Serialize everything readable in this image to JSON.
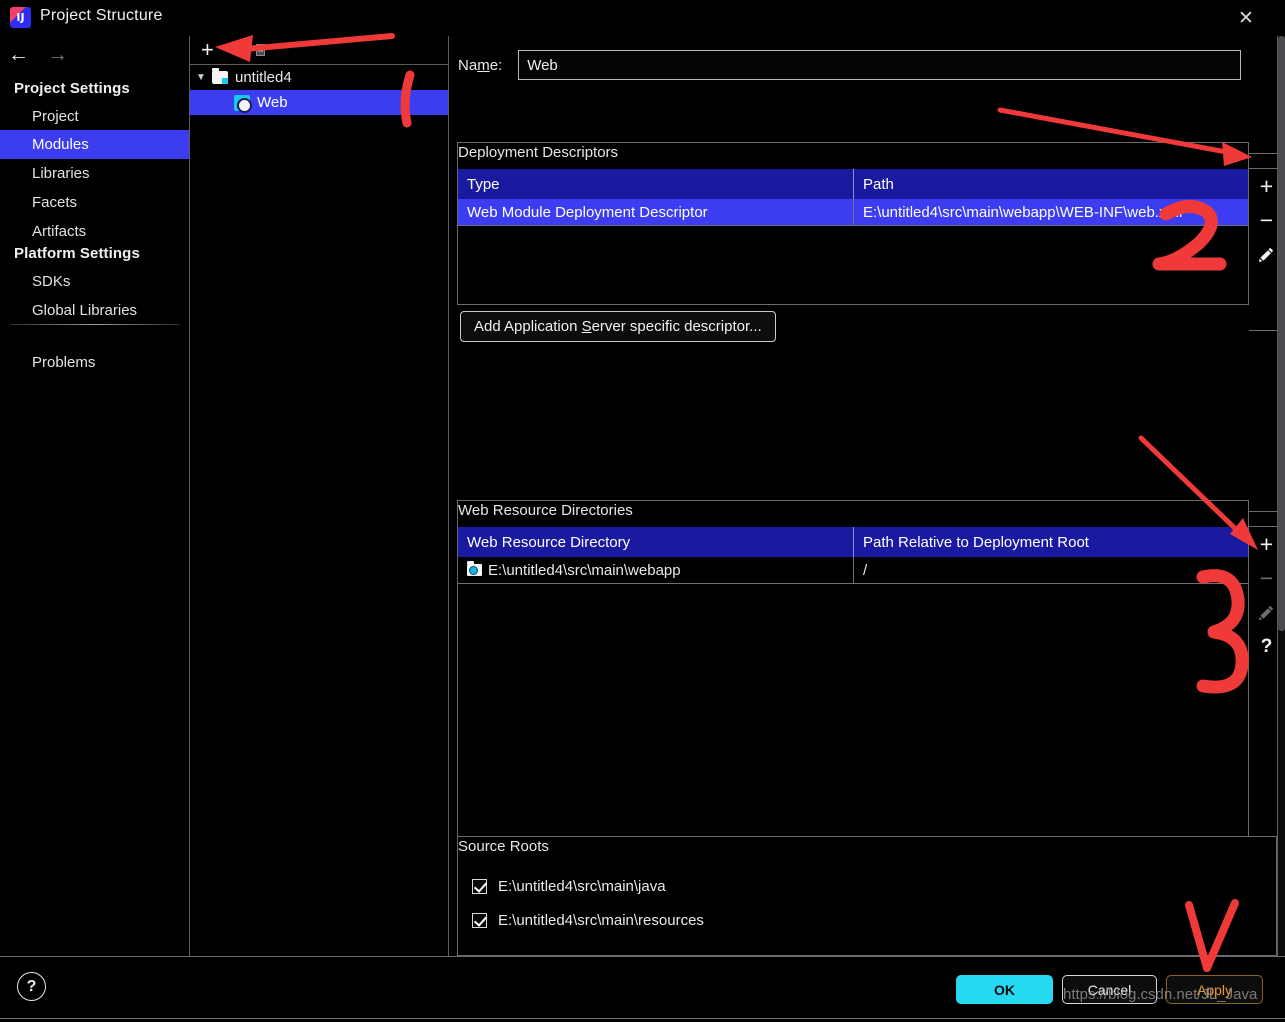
{
  "window": {
    "title": "Project Structure",
    "app_icon": "intellij-idea-icon",
    "close_icon": "close-icon"
  },
  "sidebar": {
    "back_icon": "arrow-left-icon",
    "forward_icon": "arrow-right-icon",
    "groups": [
      {
        "heading": "Project Settings",
        "items": [
          {
            "label": "Project",
            "selected": false
          },
          {
            "label": "Modules",
            "selected": true
          },
          {
            "label": "Libraries",
            "selected": false
          },
          {
            "label": "Facets",
            "selected": false
          },
          {
            "label": "Artifacts",
            "selected": false
          }
        ]
      },
      {
        "heading": "Platform Settings",
        "items": [
          {
            "label": "SDKs",
            "selected": false
          },
          {
            "label": "Global Libraries",
            "selected": false
          }
        ]
      }
    ],
    "problems_label": "Problems"
  },
  "tree": {
    "toolbar": {
      "add_icon": "plus-icon",
      "copy_icon": "copy-icon"
    },
    "nodes": [
      {
        "label": "untitled4",
        "icon": "folder-icon",
        "expanded": true,
        "selected": false
      },
      {
        "label": "Web",
        "icon": "web-module-icon",
        "selected": true
      }
    ]
  },
  "main": {
    "name": {
      "label_pre": "Na",
      "label_mnemonic": "m",
      "label_post": "e:",
      "value": "Web",
      "placeholder": ""
    },
    "deployment_descriptors": {
      "group_label": "Deployment Descriptors",
      "columns": [
        "Type",
        "Path"
      ],
      "rows": [
        {
          "type": "Web Module Deployment Descriptor",
          "path": "E:\\untitled4\\src\\main\\webapp\\WEB-INF\\web.xml",
          "selected": true
        }
      ],
      "actions": [
        {
          "name": "add-descriptor-button",
          "icon": "plus-icon",
          "glyph": "+",
          "disabled": false
        },
        {
          "name": "remove-descriptor-button",
          "icon": "minus-icon",
          "glyph": "−",
          "disabled": false
        },
        {
          "name": "edit-descriptor-button",
          "icon": "pencil-icon",
          "glyph": "pencil",
          "disabled": false
        }
      ],
      "add_app_server_button": {
        "pre": "Add Application ",
        "mnemonic": "S",
        "post": "erver specific descriptor..."
      }
    },
    "web_resource_directories": {
      "group_label": "Web Resource Directories",
      "columns": [
        "Web Resource Directory",
        "Path Relative to Deployment Root"
      ],
      "rows": [
        {
          "directory": "E:\\untitled4\\src\\main\\webapp",
          "relative_path": "/",
          "icon": "directory-icon",
          "selected": false
        }
      ],
      "actions": [
        {
          "name": "add-resource-dir-button",
          "icon": "plus-icon",
          "glyph": "+",
          "disabled": false
        },
        {
          "name": "remove-resource-dir-button",
          "icon": "minus-icon",
          "glyph": "−",
          "disabled": true
        },
        {
          "name": "edit-resource-dir-button",
          "icon": "pencil-icon",
          "glyph": "pencil",
          "disabled": true
        },
        {
          "name": "help-resource-dir-button",
          "icon": "question-mark-icon",
          "glyph": "?",
          "disabled": false
        }
      ]
    },
    "source_roots": {
      "group_label": "Source Roots",
      "items": [
        {
          "label": "E:\\untitled4\\src\\main\\java",
          "checked": true
        },
        {
          "label": "E:\\untitled4\\src\\main\\resources",
          "checked": true
        }
      ]
    }
  },
  "footer": {
    "help_icon": "question-mark-icon",
    "buttons": {
      "ok": "OK",
      "cancel": "Cancel",
      "apply": "Apply"
    }
  },
  "annotations": {
    "color": "#f03a3a",
    "marks": [
      {
        "name": "arrow-to-add-module",
        "kind": "arrow"
      },
      {
        "name": "stroke-1",
        "kind": "stroke"
      },
      {
        "name": "arrow-to-add-descriptor",
        "kind": "arrow"
      },
      {
        "name": "number-2",
        "kind": "number",
        "text": "2"
      },
      {
        "name": "arrow-to-add-resource-dir",
        "kind": "arrow"
      },
      {
        "name": "number-3",
        "kind": "number",
        "text": "3"
      },
      {
        "name": "arrow-to-apply",
        "kind": "arrow"
      }
    ]
  },
  "watermark": {
    "text": "https://blog.csdn.net/JL_Java"
  }
}
